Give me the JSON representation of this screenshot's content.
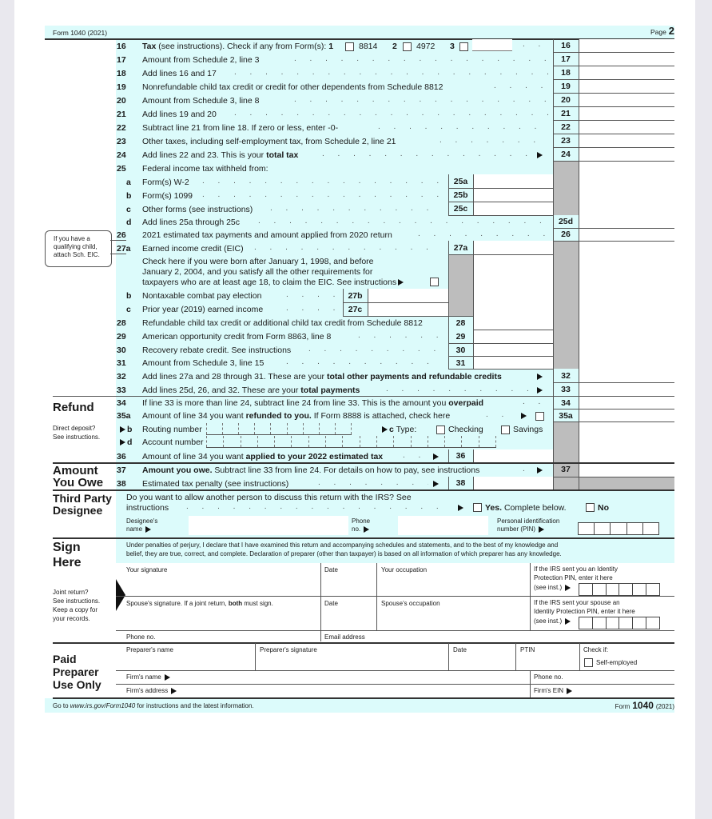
{
  "header": {
    "form_label": "Form 1040 (2021)",
    "page_label": "Page",
    "page_num": "2"
  },
  "lines": {
    "l16": {
      "num": "16",
      "text_bold": "Tax",
      "text": " (see instructions). Check if any from Form(s): ",
      "opt1": "1",
      "opt1_label": "8814",
      "opt2": "2",
      "opt2_label": "4972",
      "opt3": "3",
      "box": "16"
    },
    "l17": {
      "num": "17",
      "text": "Amount from Schedule 2, line 3",
      "box": "17"
    },
    "l18": {
      "num": "18",
      "text": "Add lines 16 and 17",
      "box": "18"
    },
    "l19": {
      "num": "19",
      "text": "Nonrefundable child tax credit or credit for other dependents from Schedule 8812",
      "box": "19"
    },
    "l20": {
      "num": "20",
      "text": "Amount from Schedule 3, line 8",
      "box": "20"
    },
    "l21": {
      "num": "21",
      "text": "Add lines 19 and 20",
      "box": "21"
    },
    "l22": {
      "num": "22",
      "text": "Subtract line 21 from line 18. If zero or less, enter -0-",
      "box": "22"
    },
    "l23": {
      "num": "23",
      "text": "Other taxes, including self-employment tax, from Schedule 2, line 21",
      "box": "23"
    },
    "l24": {
      "num": "24",
      "text": "Add lines 22 and 23. This is your ",
      "text_bold": "total tax",
      "box": "24"
    },
    "l25": {
      "num": "25",
      "text": "Federal income tax withheld from:"
    },
    "l25a": {
      "num": "a",
      "text": "Form(s) W-2",
      "box": "25a"
    },
    "l25b": {
      "num": "b",
      "text": "Form(s) 1099",
      "box": "25b"
    },
    "l25c": {
      "num": "c",
      "text": "Other forms (see instructions)",
      "box": "25c"
    },
    "l25d": {
      "num": "d",
      "text": "Add lines 25a through 25c",
      "box": "25d"
    },
    "l26": {
      "num": "26",
      "text": "2021 estimated tax payments and amount applied from 2020 return",
      "box": "26"
    },
    "l27a": {
      "num": "27a",
      "text": "Earned income credit (EIC)",
      "box": "27a",
      "check_line1": "Check here if you were born after January 1, 1998, and before",
      "check_line2": "January 2, 2004, and you satisfy all the other requirements for",
      "check_line3": "taxpayers who are at least age 18, to claim the EIC. See instructions"
    },
    "l27b": {
      "num": "b",
      "text": "Nontaxable combat pay election",
      "box": "27b"
    },
    "l27c": {
      "num": "c",
      "text": "Prior year (2019) earned income",
      "box": "27c"
    },
    "l28": {
      "num": "28",
      "text": "Refundable child tax credit or additional child tax credit from Schedule 8812",
      "box": "28"
    },
    "l29": {
      "num": "29",
      "text": "American opportunity credit from Form 8863, line 8",
      "box": "29"
    },
    "l30": {
      "num": "30",
      "text": "Recovery rebate credit. See instructions",
      "box": "30"
    },
    "l31": {
      "num": "31",
      "text": "Amount from Schedule 3, line 15",
      "box": "31"
    },
    "l32": {
      "num": "32",
      "text": "Add lines 27a and 28 through 31. These are your ",
      "text_bold": "total other payments and refundable credits",
      "box": "32"
    },
    "l33": {
      "num": "33",
      "text": "Add lines 25d, 26, and 32. These are your ",
      "text_bold": "total payments",
      "box": "33"
    },
    "l34": {
      "num": "34",
      "text": "If line 33 is more than line 24, subtract line 24 from line 33. This is the amount you ",
      "text_bold": "overpaid",
      "box": "34"
    },
    "l35a": {
      "num": "35a",
      "text": "Amount of line 34 you want ",
      "text_bold": "refunded to you.",
      "text2": " If Form 8888 is attached, check here",
      "box": "35a"
    },
    "l35b": {
      "num": "b",
      "text": "Routing number",
      "type_label": "c",
      "type_text": "Type:",
      "checking": "Checking",
      "savings": "Savings"
    },
    "l35d": {
      "num": "d",
      "text": "Account number"
    },
    "l36": {
      "num": "36",
      "text": "Amount of line 34 you want ",
      "text_bold": "applied to your 2022 estimated tax",
      "box": "36"
    },
    "l37": {
      "num": "37",
      "text_bold": "Amount you owe.",
      "text": " Subtract line 33 from line 24. For details on how to pay, see instructions",
      "box": "37"
    },
    "l38": {
      "num": "38",
      "text": "Estimated tax penalty (see instructions)",
      "box": "38"
    }
  },
  "eic_note": {
    "line1": "If you have a",
    "line2": "qualifying child,",
    "line3": "attach Sch. EIC."
  },
  "refund": {
    "title": "Refund",
    "note1": "Direct deposit?",
    "note2": "See instructions."
  },
  "owe": {
    "title1": "Amount",
    "title2": "You Owe"
  },
  "designee": {
    "title1": "Third Party",
    "title2": "Designee",
    "question1": "Do you want to allow another person to discuss this return with the IRS? See",
    "question2": "instructions",
    "yes_bold": "Yes.",
    "yes_text": " Complete below.",
    "no": "No",
    "name_label1": "Designee's",
    "name_label2": "name",
    "phone_label1": "Phone",
    "phone_label2": "no.",
    "pin_label1": "Personal identification",
    "pin_label2": "number (PIN)"
  },
  "sign": {
    "title1": "Sign",
    "title2": "Here",
    "declaration1": "Under penalties of perjury, I declare that I have examined this return and accompanying schedules and statements, and to the best of my knowledge and",
    "declaration2": "belief, they are true, correct, and complete. Declaration of preparer (other than taxpayer) is based on all information of which preparer has any knowledge.",
    "your_signature": "Your signature",
    "date": "Date",
    "your_occupation": "Your occupation",
    "ippin1": "If the IRS sent you an Identity",
    "ippin2": "Protection PIN, enter it here",
    "ippin3": "(see inst.)",
    "spouse_signature": "Spouse's signature. If a joint return, ",
    "spouse_bold": "both",
    "spouse_tail": " must sign.",
    "spouse_occupation": "Spouse's occupation",
    "sp_ippin1": "If the IRS sent your spouse an",
    "sp_ippin2": "Identity Protection PIN, enter it here",
    "sp_ippin3": "(see inst.)",
    "phone": "Phone no.",
    "email": "Email address",
    "note1": "Joint return?",
    "note2": "See instructions.",
    "note3": "Keep a copy for",
    "note4": "your records."
  },
  "preparer": {
    "title1": "Paid",
    "title2": "Preparer",
    "title3": "Use Only",
    "name": "Preparer's name",
    "signature": "Preparer's signature",
    "date": "Date",
    "ptin": "PTIN",
    "check_if": "Check if:",
    "self_employed": "Self-employed",
    "firm_name": "Firm's name",
    "firm_address": "Firm's address",
    "phone": "Phone no.",
    "ein": "Firm's EIN"
  },
  "footer": {
    "go_to": "Go to ",
    "url": "www.irs.gov/Form1040",
    "go_tail": " for instructions and the latest information.",
    "form_word": "Form",
    "form_num": "1040",
    "form_year": "(2021)"
  }
}
